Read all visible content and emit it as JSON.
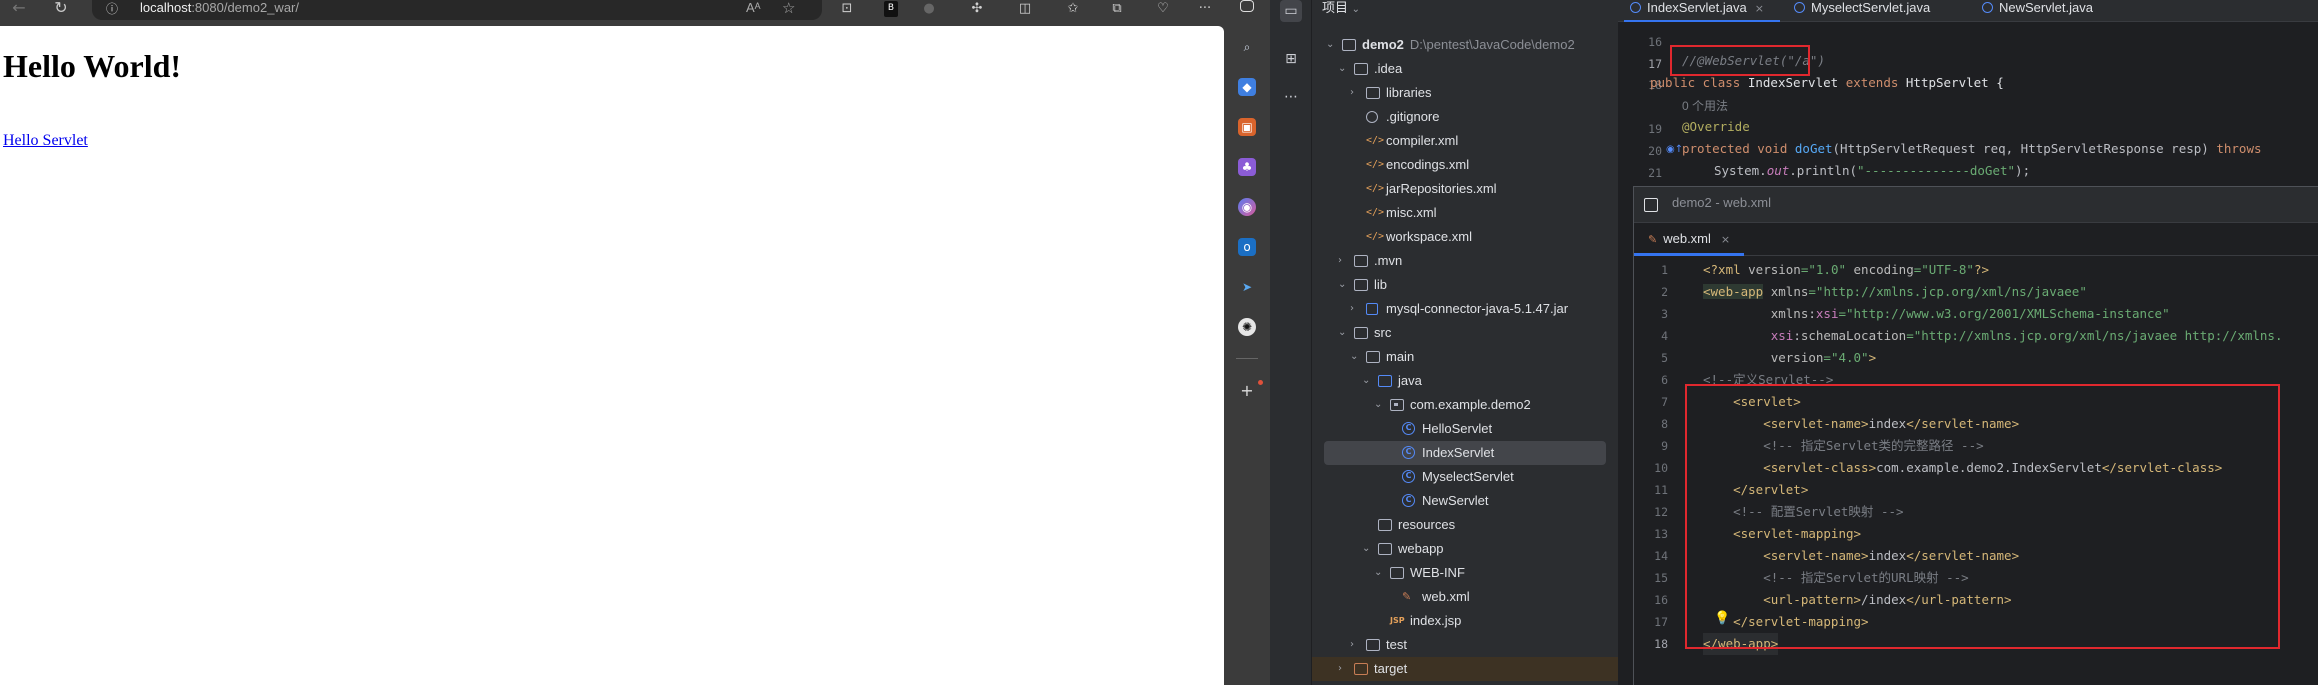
{
  "browser": {
    "url_host": "localhost",
    "url_rest": ":8080/demo2_war/",
    "page_heading": "Hello World!",
    "page_link": "Hello Servlet"
  },
  "ide": {
    "project_header": "项目",
    "tree": [
      {
        "label": "demo2",
        "path": "D:\\pentest\\JavaCode\\demo2",
        "icon": "folder-icon"
      },
      {
        "label": ".idea",
        "icon": "folder-icon"
      },
      {
        "label": "libraries",
        "icon": "folder-icon"
      },
      {
        "label": ".gitignore",
        "icon": "ignore-file-icon"
      },
      {
        "label": "compiler.xml",
        "icon": "xml-file-icon"
      },
      {
        "label": "encodings.xml",
        "icon": "xml-file-icon"
      },
      {
        "label": "jarRepositories.xml",
        "icon": "xml-file-icon"
      },
      {
        "label": "misc.xml",
        "icon": "xml-file-icon"
      },
      {
        "label": "workspace.xml",
        "icon": "xml-file-icon"
      },
      {
        "label": ".mvn",
        "icon": "folder-icon"
      },
      {
        "label": "lib",
        "icon": "folder-icon"
      },
      {
        "label": "mysql-connector-java-5.1.47.jar",
        "icon": "jar-icon"
      },
      {
        "label": "src",
        "icon": "folder-icon"
      },
      {
        "label": "main",
        "icon": "folder-icon"
      },
      {
        "label": "java",
        "icon": "source-folder-icon"
      },
      {
        "label": "com.example.demo2",
        "icon": "package-icon"
      },
      {
        "label": "HelloServlet",
        "icon": "class-icon"
      },
      {
        "label": "IndexServlet",
        "icon": "class-icon"
      },
      {
        "label": "MyselectServlet",
        "icon": "class-icon"
      },
      {
        "label": "NewServlet",
        "icon": "class-icon"
      },
      {
        "label": "resources",
        "icon": "resources-folder-icon"
      },
      {
        "label": "webapp",
        "icon": "folder-icon"
      },
      {
        "label": "WEB-INF",
        "icon": "folder-icon"
      },
      {
        "label": "web.xml",
        "icon": "web-xml-icon"
      },
      {
        "label": "index.jsp",
        "icon": "jsp-icon"
      },
      {
        "label": "test",
        "icon": "folder-icon"
      },
      {
        "label": "target",
        "icon": "excluded-folder-icon"
      }
    ],
    "tabs": [
      {
        "label": "IndexServlet.java"
      },
      {
        "label": "MyselectServlet.java"
      },
      {
        "label": "NewServlet.java"
      }
    ],
    "java_lines": {
      "n16": "16",
      "n17": "17",
      "n18": "18",
      "n19": "19",
      "n20": "20",
      "n21": "21",
      "l17": "//@WebServlet(\"/a\")",
      "usage_hint": "0 个用法"
    },
    "popup": {
      "title": "demo2 - web.xml",
      "tab": "web.xml"
    },
    "xml_line_numbers": [
      "1",
      "2",
      "3",
      "4",
      "5",
      "6",
      "7",
      "8",
      "9",
      "10",
      "11",
      "12",
      "13",
      "14",
      "15",
      "16",
      "17",
      "18"
    ],
    "xml_comments": {
      "c6": "<!--定义Servlet-->",
      "c9": "<!-- 指定Servlet类的完整路径 -->",
      "c12": "<!-- 配置Servlet映射 -->",
      "c15": "<!-- 指定Servlet的URL映射 -->"
    },
    "xml_values": {
      "name": "index",
      "class": "com.example.demo2.IndexServlet",
      "pattern": "/index"
    }
  }
}
